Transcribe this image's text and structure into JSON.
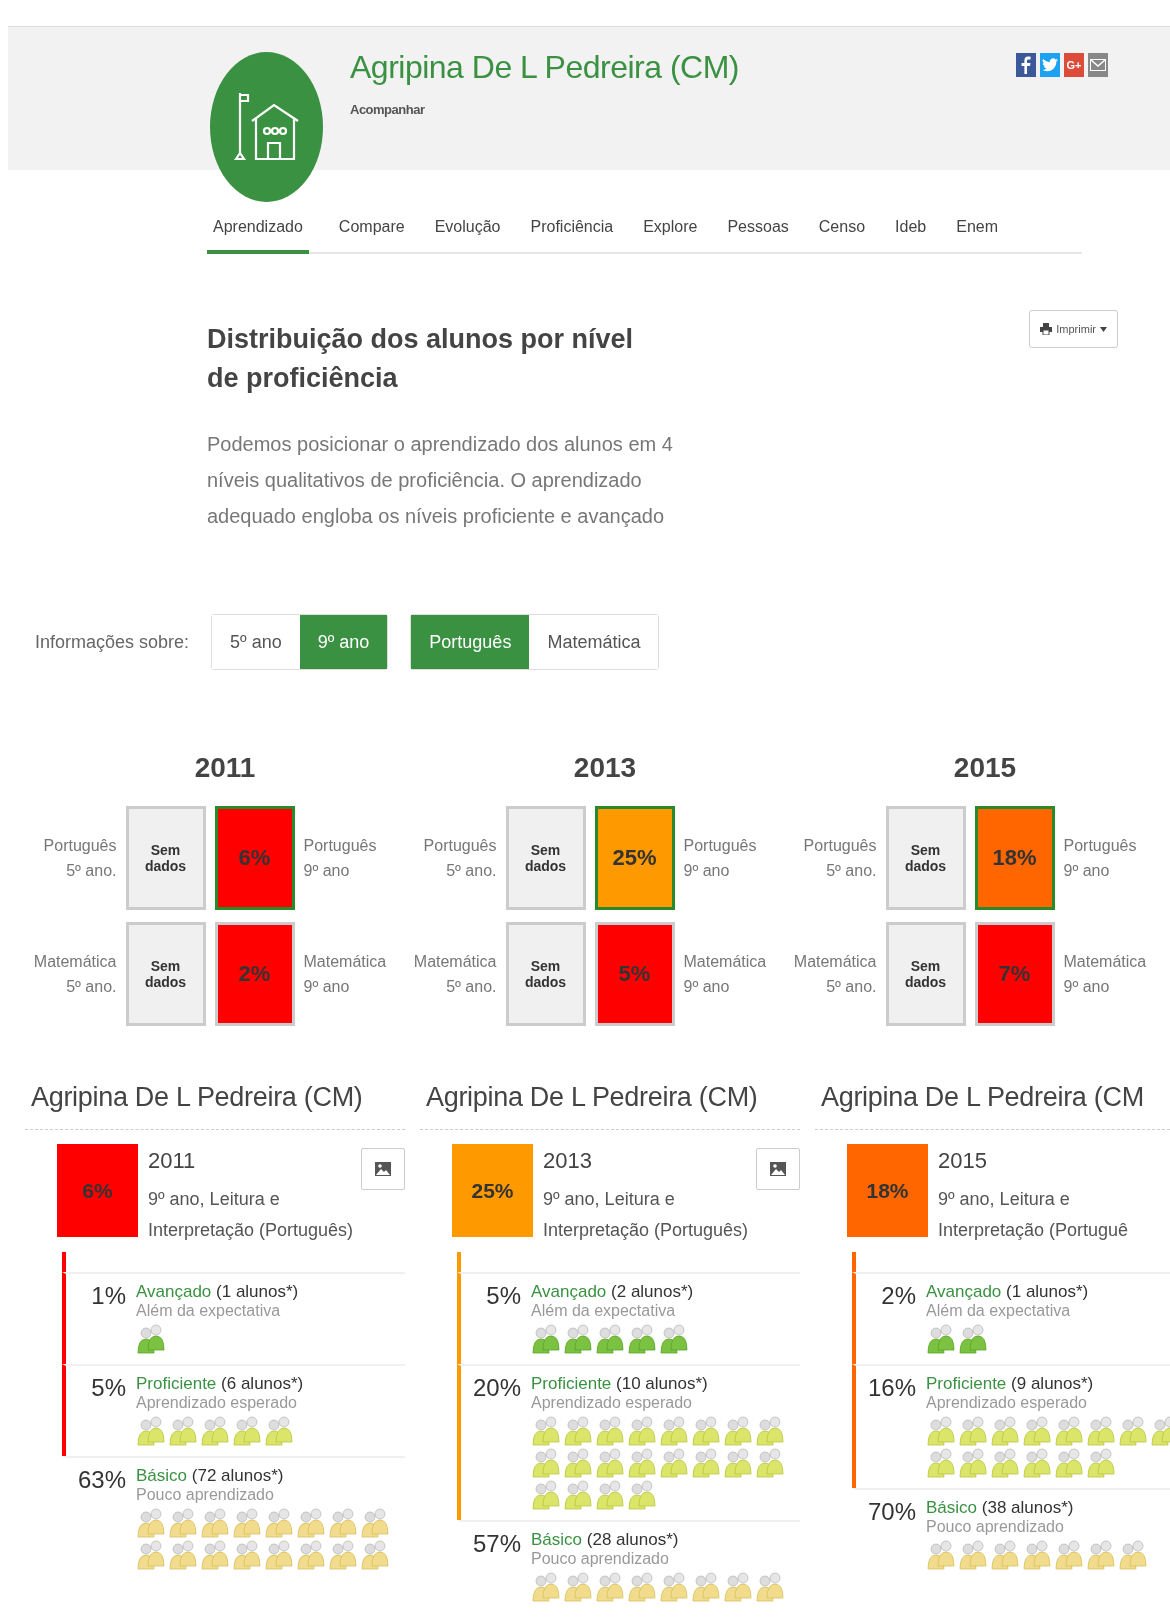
{
  "header": {
    "title": "Agripina De L Pedreira (CM)",
    "follow": "Acompanhar",
    "share": [
      {
        "kind": "facebook"
      },
      {
        "kind": "twitter"
      },
      {
        "kind": "google",
        "label": "G+"
      },
      {
        "kind": "email"
      }
    ]
  },
  "tabs": [
    {
      "label": "Aprendizado",
      "selected": true
    },
    {
      "label": "Compare",
      "selected": false
    },
    {
      "label": "Evolução",
      "selected": false
    },
    {
      "label": "Proficiência",
      "selected": false
    },
    {
      "label": "Explore",
      "selected": false
    },
    {
      "label": "Pessoas",
      "selected": false
    },
    {
      "label": "Censo",
      "selected": false
    },
    {
      "label": "Ideb",
      "selected": false
    },
    {
      "label": "Enem",
      "selected": false
    }
  ],
  "section": {
    "title": "Distribuição dos alunos por nível de proficiência",
    "description": "Podemos posicionar o aprendizado dos alunos em 4 níveis qualitativos de proficiência. O aprendizado adequado engloba os níveis proficiente e avançado",
    "print_button": "Imprimir"
  },
  "filters": {
    "label": "Informações sobre:",
    "grades": [
      {
        "label": "5º ano",
        "selected": false
      },
      {
        "label": "9º ano",
        "selected": true
      }
    ],
    "subjects": [
      {
        "label": "Português",
        "selected": true
      },
      {
        "label": "Matemática",
        "selected": false
      }
    ]
  },
  "years": [
    {
      "year": "2011",
      "rows": [
        {
          "left_subject": "Português",
          "left_grade": "5º ano.",
          "left_value": "Sem dados",
          "right": {
            "value": "6%",
            "color": "#ff0000",
            "selected": true
          },
          "right_subject": "Português",
          "right_grade": "9º ano"
        },
        {
          "left_subject": "Matemática",
          "left_grade": "5º ano.",
          "left_value": "Sem dados",
          "right": {
            "value": "2%",
            "color": "#ff0000",
            "selected": false
          },
          "right_subject": "Matemática",
          "right_grade": "9º ano"
        }
      ]
    },
    {
      "year": "2013",
      "rows": [
        {
          "left_subject": "Português",
          "left_grade": "5º ano.",
          "left_value": "Sem dados",
          "right": {
            "value": "25%",
            "color": "#ff9900",
            "selected": true
          },
          "right_subject": "Português",
          "right_grade": "9º ano"
        },
        {
          "left_subject": "Matemática",
          "left_grade": "5º ano.",
          "left_value": "Sem dados",
          "right": {
            "value": "5%",
            "color": "#ff0000",
            "selected": false
          },
          "right_subject": "Matemática",
          "right_grade": "9º ano"
        }
      ]
    },
    {
      "year": "2015",
      "rows": [
        {
          "left_subject": "Português",
          "left_grade": "5º ano.",
          "left_value": "Sem dados",
          "right": {
            "value": "18%",
            "color": "#ff6600",
            "selected": true
          },
          "right_subject": "Português",
          "right_grade": "9º ano"
        },
        {
          "left_subject": "Matemática",
          "left_grade": "5º ano.",
          "left_value": "Sem dados",
          "right": {
            "value": "7%",
            "color": "#ff0000",
            "selected": false
          },
          "right_subject": "Matemática",
          "right_grade": "9º ano"
        }
      ]
    }
  ],
  "cards": [
    {
      "school": "Agripina De L Pedreira (CM)",
      "value": "6%",
      "color": "#ff0000",
      "year": "2011",
      "description": "9º ano, Leitura e Interpretação (Português)",
      "has_image_button": true,
      "levels": [
        {
          "kind": "avancado",
          "percent": "1%",
          "name": "Avançado",
          "count": "(1 alunos*)",
          "note": "Além da expectativa"
        },
        {
          "kind": "proficiente",
          "percent": "5%",
          "name": "Proficiente",
          "count": "(6 alunos*)",
          "note": "Aprendizado esperado"
        },
        {
          "kind": "basico",
          "percent": "63%",
          "name": "Básico",
          "count": "(72 alunos*)",
          "note": "Pouco aprendizado"
        }
      ]
    },
    {
      "school": "Agripina De L Pedreira (CM)",
      "value": "25%",
      "color": "#ff9900",
      "year": "2013",
      "description": "9º ano, Leitura e Interpretação (Português)",
      "has_image_button": true,
      "levels": [
        {
          "kind": "avancado",
          "percent": "5%",
          "name": "Avançado",
          "count": "(2 alunos*)",
          "note": "Além da expectativa"
        },
        {
          "kind": "proficiente",
          "percent": "20%",
          "name": "Proficiente",
          "count": "(10 alunos*)",
          "note": "Aprendizado esperado"
        },
        {
          "kind": "basico",
          "percent": "57%",
          "name": "Básico",
          "count": "(28 alunos*)",
          "note": "Pouco aprendizado"
        }
      ]
    },
    {
      "school": "Agripina De L Pedreira (CM",
      "value": "18%",
      "color": "#ff6600",
      "year": "2015",
      "description": "9º ano, Leitura e Interpretação (Portuguê",
      "has_image_button": false,
      "levels": [
        {
          "kind": "avancado",
          "percent": "2%",
          "name": "Avançado",
          "count": "(1 alunos*)",
          "note": "Além da expectativa"
        },
        {
          "kind": "proficiente",
          "percent": "16%",
          "name": "Proficiente",
          "count": "(9 alunos*)",
          "note": "Aprendizado esperado"
        },
        {
          "kind": "basico",
          "percent": "70%",
          "name": "Básico",
          "count": "(38 alunos*)",
          "note": "Pouco aprendizado"
        }
      ]
    }
  ]
}
